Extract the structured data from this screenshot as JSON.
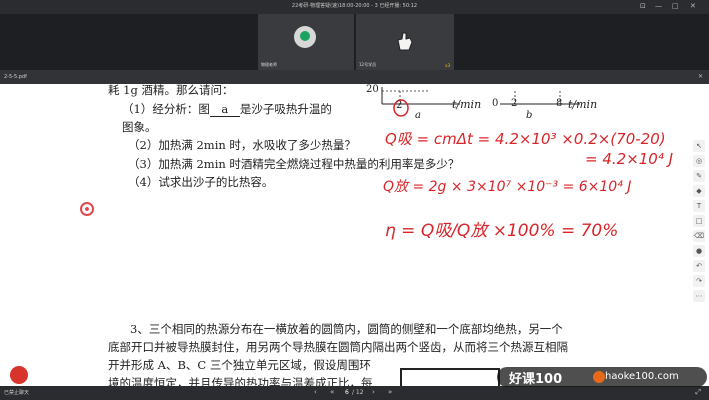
{
  "meeting": {
    "title": "22考研-物理答疑(速)18:00-20:00 - 3    已经开播: 50:12",
    "tiles": [
      {
        "label": "物理老师"
      },
      {
        "label": "12号学员",
        "badge": "x3"
      }
    ]
  },
  "tab": {
    "name": "2-5-5.pdf"
  },
  "problem": {
    "line0": "耗 1g 酒精。那么请问：",
    "q1_prefix": "（1）经分析：图",
    "q1_blank": "a",
    "q1_suffix": "是沙子吸热升温的",
    "q1_cont": "图象。",
    "q2": "（2）加热满 2min 时，水吸收了多少热量？",
    "q3": "（3）加热满 2min 时酒精完全燃烧过程中热量的利用率是多少？",
    "q4": "（4）试求出沙子的比热容。",
    "p3_l1": "3、三个相同的热源分布在一横放着的圆筒内，圆筒的侧壁和一个底部均绝热，另一个",
    "p3_l2": "底部开口并被导热膜封住，用另两个导热膜在圆筒内隔出两个竖齿，从而将三个热源互相隔",
    "p3_l3": "开并形成 A、B、C 三个独立单元区域，假设周围环",
    "p3_l4": "境的温度恒定，并且传导的热功率与温差成正比，每"
  },
  "graph_labels": {
    "y20": "20",
    "t_a": "t/min",
    "a": "a",
    "zero": "0",
    "two": "2",
    "eight": "8",
    "t_b": "t/min",
    "b": "b",
    "two_small": "2"
  },
  "handwriting": {
    "line1": "Q吸 = cmΔt = 4.2×10³ ×0.2×(70-20)",
    "line2": "= 4.2×10⁴ J",
    "line3": "Q放 = 2g    × 3×10⁷ ×10⁻³ = 6×10⁴ J",
    "line4": "η = Q吸/Q放  ×100% = 70%"
  },
  "pager": {
    "current": "6",
    "total": "/ 12"
  },
  "bottom": {
    "left": "已禁止聊天"
  },
  "watermark": {
    "brand": "好课100",
    "url": "haoke100.com"
  },
  "colors": {
    "ink": "#d8252a",
    "accent": "#1aa361"
  }
}
